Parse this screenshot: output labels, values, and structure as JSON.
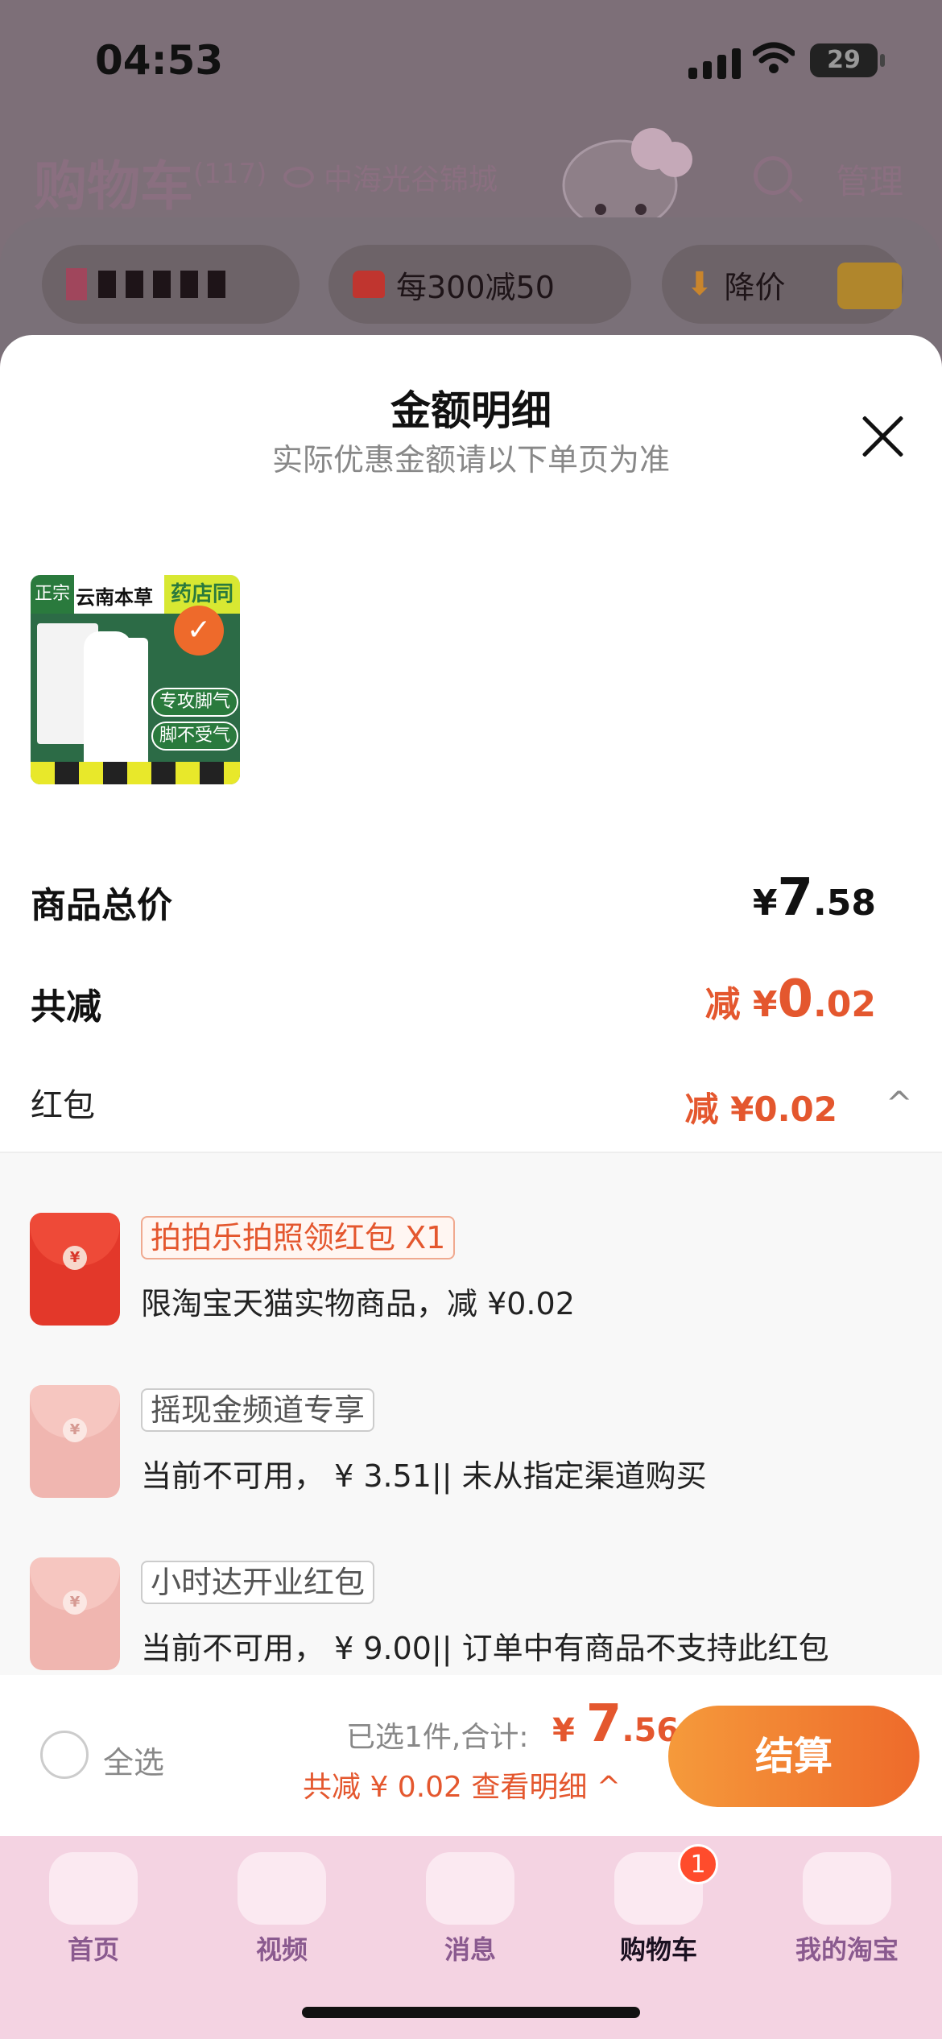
{
  "status_bar": {
    "time": "04:53",
    "battery": "29"
  },
  "background": {
    "title": "购物车",
    "count": "(117)",
    "location": "中海光谷锦城",
    "manage": "管理",
    "chips": [
      "每300减50",
      "降价"
    ]
  },
  "sheet": {
    "title": "金额明细",
    "subtitle": "实际优惠金额请以下单页为准",
    "product_banner": "药店同款",
    "product_badge_text": "正宗",
    "product_brand": "云南本草",
    "product_tag1": "专攻脚气",
    "product_tag2": "脚不受气",
    "rows": {
      "total_label": "商品总价",
      "total_symbol": "¥",
      "total_int": "7",
      "total_dec": ".58",
      "discount_label": "共减",
      "discount_prefix": "减 ¥",
      "discount_int": "0",
      "discount_dec": ".02",
      "hongbao_label": "红包",
      "hongbao_value": "减 ¥0.02"
    },
    "coupons": [
      {
        "tag": "拍拍乐拍照领红包 X1",
        "desc": "限淘宝天猫实物商品，减 ¥0.02"
      },
      {
        "tag": "摇现金频道专享",
        "desc": "当前不可用， ¥ 3.51|| 未从指定渠道购买"
      },
      {
        "tag": "小时达开业红包",
        "desc": "当前不可用， ¥ 9.00|| 订单中有商品不支持此红包"
      }
    ]
  },
  "bottom_bar": {
    "select_all": "全选",
    "selected_text": "已选1件,合计:",
    "price_symbol": "¥",
    "price_int": "7",
    "price_dec": ".56",
    "save_text": "共减 ¥ 0.02  查看明细 ^",
    "checkout": "结算"
  },
  "tabs": [
    {
      "label": "首页"
    },
    {
      "label": "视频"
    },
    {
      "label": "消息"
    },
    {
      "label": "购物车",
      "badge": "1"
    },
    {
      "label": "我的淘宝"
    }
  ],
  "colors": {
    "accent": "#e4572e",
    "checkout_start": "#f59a3b",
    "checkout_end": "#ee6a2b",
    "tabbar": "#f4d3e2"
  }
}
